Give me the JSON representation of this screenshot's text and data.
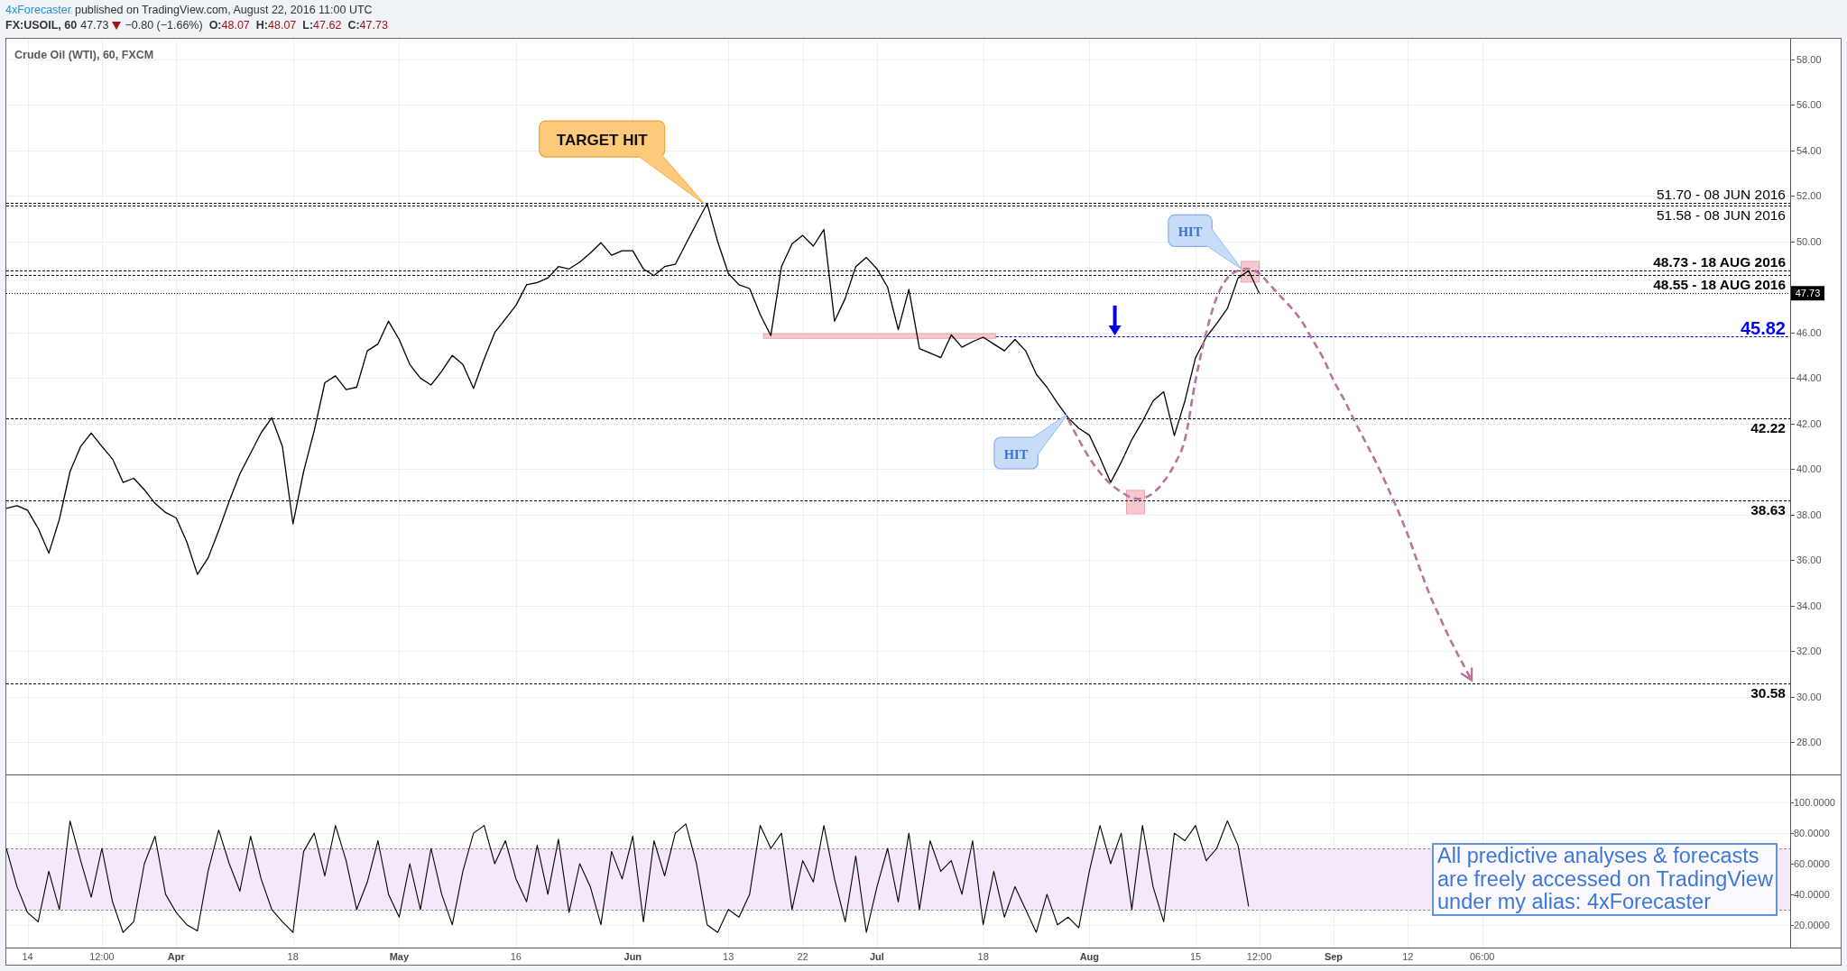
{
  "header": {
    "author": "4xForecaster",
    "published": "published on TradingView.com, August 22, 2016 11:00 UTC"
  },
  "quote": {
    "symbol": "FX:USOIL, 60",
    "last": "47.73",
    "falling": true,
    "change": "−0.80 (−1.66%)",
    "ohlc": [
      {
        "label": "O:",
        "value": "48.07"
      },
      {
        "label": "H:",
        "value": "48.07"
      },
      {
        "label": "L:",
        "value": "47.62"
      },
      {
        "label": "C:",
        "value": "47.73"
      }
    ]
  },
  "chart": {
    "price_pane": {
      "last_price_label": "47.73",
      "chart_data": {
        "type": "line",
        "title": "Crude Oil (WTI), 60, FXCM",
        "grid": true,
        "categories": [
          null,
          null,
          null,
          null,
          null,
          null,
          null,
          null,
          null,
          null,
          null,
          null,
          null,
          null,
          null,
          null,
          null,
          null,
          null,
          null,
          null,
          null,
          null,
          null,
          null,
          null,
          null,
          null,
          null,
          null,
          null,
          null,
          null,
          null,
          null,
          null,
          null,
          null,
          null,
          null,
          null,
          null,
          null,
          null,
          null,
          null,
          null,
          null,
          null,
          null,
          null,
          null,
          null,
          null,
          null,
          null,
          null,
          null,
          null,
          null,
          null,
          null,
          null,
          null,
          null,
          null,
          null,
          null,
          null,
          null,
          null,
          null,
          null,
          null,
          null,
          null,
          null,
          null,
          null,
          null,
          null,
          null,
          null,
          null,
          null,
          null,
          null,
          null,
          null,
          null,
          null,
          null,
          null,
          null,
          null,
          null,
          null,
          null,
          null,
          null,
          null,
          null,
          null,
          null,
          null,
          null,
          null,
          null,
          null,
          null,
          null,
          null,
          null,
          null,
          null,
          null,
          null,
          null,
          null,
          null,
          null,
          null,
          null,
          null,
          null,
          null,
          null,
          null,
          null,
          null,
          null,
          null,
          null,
          null,
          null,
          null,
          null,
          null,
          null,
          null,
          null,
          null,
          null,
          null,
          null,
          null,
          null,
          null,
          null,
          null,
          null,
          null,
          null,
          null,
          null,
          null,
          null,
          null,
          null,
          null,
          null,
          null,
          null,
          null,
          null,
          null,
          null,
          null,
          null
        ],
        "series": [
          {
            "color": "#000000",
            "values": [
              38.28,
              38.4,
              38.2,
              37.4,
              36.31,
              37.8,
              39.9,
              41.0,
              41.59,
              41.0,
              40.45,
              39.42,
              39.6,
              39.1,
              38.5,
              38.1,
              37.86,
              36.8,
              35.38,
              36.1,
              37.3,
              38.6,
              39.8,
              40.7,
              41.6,
              42.26,
              41.0,
              37.6,
              39.9,
              41.7,
              43.8,
              44.1,
              43.5,
              43.6,
              45.2,
              45.5,
              46.5,
              45.7,
              44.6,
              44.0,
              43.7,
              44.3,
              45.0,
              44.6,
              43.55,
              44.84,
              46.0,
              46.6,
              47.2,
              48.1,
              48.2,
              48.4,
              48.9,
              48.8,
              49.1,
              49.49,
              49.95,
              49.4,
              49.6,
              49.6,
              48.8,
              48.5,
              48.9,
              49.0,
              49.9,
              50.79,
              51.67,
              50.0,
              48.6,
              48.1,
              47.94,
              46.8,
              45.87,
              48.9,
              49.9,
              50.27,
              49.8,
              50.53,
              46.5,
              47.5,
              48.9,
              49.3,
              48.8,
              48.0,
              46.13,
              47.9,
              45.3,
              45.1,
              44.9,
              45.9,
              45.36,
              45.6,
              45.8,
              45.5,
              45.2,
              45.7,
              45.2,
              44.17,
              43.6,
              42.9,
              42.26,
              41.8,
              41.5,
              40.5,
              39.42,
              40.3,
              41.3,
              42.1,
              43.0,
              43.4,
              41.48,
              43.0,
              44.9,
              45.8,
              46.4,
              47.06,
              48.4,
              48.72,
              47.73,
              null,
              null,
              null,
              null,
              null,
              null,
              null,
              null,
              null,
              null,
              null,
              null,
              null,
              null,
              null,
              null,
              null,
              null,
              null,
              null,
              null,
              null,
              null,
              null,
              null,
              null,
              null,
              null,
              null,
              null,
              null,
              null,
              null,
              null,
              null,
              null,
              null,
              null,
              null,
              null,
              null,
              null,
              null,
              null,
              null,
              null,
              null,
              null,
              null,
              null
            ]
          },
          {
            "color": "#b8749c",
            "line_style": "dashed",
            "values": [
              null,
              null,
              null,
              null,
              null,
              null,
              null,
              null,
              null,
              null,
              null,
              null,
              null,
              null,
              null,
              null,
              null,
              null,
              null,
              null,
              null,
              null,
              null,
              null,
              null,
              null,
              null,
              null,
              null,
              null,
              null,
              null,
              null,
              null,
              null,
              null,
              null,
              null,
              null,
              null,
              null,
              null,
              null,
              null,
              null,
              null,
              null,
              null,
              null,
              null,
              null,
              null,
              null,
              null,
              null,
              null,
              null,
              null,
              null,
              null,
              null,
              null,
              null,
              null,
              null,
              null,
              null,
              null,
              null,
              null,
              null,
              null,
              null,
              null,
              null,
              null,
              null,
              null,
              null,
              null,
              null,
              null,
              null,
              null,
              null,
              null,
              null,
              null,
              null,
              null,
              null,
              null,
              null,
              null,
              null,
              null,
              null,
              null,
              null,
              null,
              42.2,
              41.3,
              40.5,
              39.85,
              39.35,
              39.0,
              38.75,
              38.72,
              38.95,
              39.45,
              40.2,
              41.3,
              43.9,
              46.0,
              47.55,
              48.4,
              48.72,
              48.8,
              48.6,
              48.1,
              47.6,
              47.1,
              46.5,
              45.7,
              44.9,
              43.9,
              43.05,
              42.1,
              41.2,
              40.3,
              39.3,
              38.25,
              37.1,
              35.8,
              34.55,
              33.5,
              32.5,
              31.6,
              30.73,
              null,
              null,
              null,
              null,
              null,
              null,
              null,
              null,
              null,
              null,
              null,
              null,
              null,
              null,
              null,
              null,
              null,
              null,
              null,
              null,
              null,
              null,
              null,
              null,
              null,
              null,
              null,
              null,
              null,
              null
            ]
          }
        ],
        "ylim": [
          26.59,
          58.91
        ],
        "yticks": [
          {
            "value": 58,
            "label": "58.00"
          },
          {
            "value": 56,
            "label": "56.00"
          },
          {
            "value": 54,
            "label": "54.00"
          },
          {
            "value": 52,
            "label": "52.00"
          },
          {
            "value": 50,
            "label": "50.00"
          },
          {
            "value": 46,
            "label": "46.00"
          },
          {
            "value": 44,
            "label": "44.00"
          },
          {
            "value": 42,
            "label": "42.00"
          },
          {
            "value": 40,
            "label": "40.00"
          },
          {
            "value": 38,
            "label": "38.00"
          },
          {
            "value": 36,
            "label": "36.00"
          },
          {
            "value": 34,
            "label": "34.00"
          },
          {
            "value": 32,
            "label": "32.00"
          },
          {
            "value": 30,
            "label": "30.00"
          },
          {
            "value": 28,
            "label": "28.00"
          }
        ],
        "ref_lines": [
          {
            "axis": "y",
            "value": 51.7,
            "label": "51.70 - 08 JUN 2016",
            "color": "#000000"
          },
          {
            "axis": "y",
            "value": 51.58,
            "label": "51.58 - 08 JUN 2016",
            "color": "#000000"
          },
          {
            "axis": "y",
            "value": 48.73,
            "label": "48.73 - 18 AUG 2016",
            "color": "#000000"
          },
          {
            "axis": "y",
            "value": 48.55,
            "label": "48.55 - 18 AUG 2016",
            "color": "#000000"
          },
          {
            "axis": "y",
            "value": 47.73,
            "color": "#000000"
          },
          {
            "axis": "y",
            "value": 45.82,
            "label": "45.82",
            "color": "#0000ff"
          },
          {
            "axis": "y",
            "value": 42.22,
            "label": "42.22",
            "color": "#000000"
          },
          {
            "axis": "y",
            "value": 38.63,
            "label": "38.63",
            "color": "#000000"
          },
          {
            "axis": "y",
            "value": 30.58,
            "label": "30.58",
            "color": "#000000"
          }
        ],
        "annotations": [
          "TARGET HIT",
          "HIT",
          "HIT"
        ]
      }
    },
    "oscillator_pane": {
      "note": "All predictive analyses & forecasts\nare freely accessed on TradingView\nunder my alias: 4xForecaster",
      "chart_data": {
        "type": "line",
        "grid": true,
        "categories": [
          null,
          null,
          "14",
          null,
          null,
          null,
          null,
          null,
          null,
          "12:00",
          null,
          null,
          null,
          null,
          null,
          null,
          "Apr",
          null,
          null,
          null,
          null,
          null,
          null,
          null,
          null,
          null,
          null,
          "18",
          null,
          null,
          null,
          null,
          null,
          null,
          null,
          null,
          null,
          "May",
          null,
          null,
          null,
          null,
          null,
          null,
          null,
          null,
          null,
          null,
          "16",
          null,
          null,
          null,
          null,
          null,
          null,
          null,
          null,
          null,
          null,
          "Jun",
          null,
          null,
          null,
          null,
          null,
          null,
          null,
          null,
          "13",
          null,
          null,
          null,
          null,
          null,
          null,
          "22",
          null,
          null,
          null,
          null,
          null,
          null,
          "Jul",
          null,
          null,
          null,
          null,
          null,
          null,
          null,
          null,
          null,
          "18",
          null,
          null,
          null,
          null,
          null,
          null,
          null,
          null,
          null,
          "Aug",
          null,
          null,
          null,
          null,
          null,
          null,
          null,
          null,
          null,
          "15",
          null,
          null,
          null,
          null,
          null,
          "12:00",
          null,
          null,
          null,
          null,
          null,
          null,
          "Sep",
          null,
          null,
          null,
          null,
          null,
          null,
          "12",
          null,
          null,
          null,
          null,
          null,
          null,
          "06:00",
          null,
          null,
          null,
          null,
          null,
          null,
          null,
          null,
          null,
          null,
          null,
          null,
          null,
          null,
          null,
          null,
          null,
          null,
          null,
          null,
          null,
          null,
          null,
          null,
          null,
          null,
          null,
          null,
          null
        ],
        "values": [
          70,
          45,
          28,
          22,
          55,
          30,
          88,
          62,
          38,
          70,
          35,
          15,
          22,
          60,
          78,
          40,
          28,
          20,
          16,
          55,
          82,
          60,
          42,
          78,
          50,
          30,
          22,
          15,
          68,
          80,
          52,
          85,
          62,
          30,
          48,
          75,
          40,
          25,
          60,
          30,
          70,
          40,
          20,
          55,
          80,
          85,
          60,
          75,
          50,
          35,
          72,
          40,
          76,
          28,
          60,
          45,
          20,
          68,
          50,
          78,
          22,
          75,
          52,
          80,
          86,
          60,
          20,
          15,
          30,
          25,
          40,
          85,
          70,
          80,
          30,
          62,
          48,
          85,
          50,
          22,
          65,
          15,
          45,
          70,
          35,
          80,
          30,
          75,
          55,
          62,
          40,
          75,
          20,
          55,
          25,
          45,
          30,
          15,
          40,
          20,
          25,
          18,
          55,
          85,
          60,
          80,
          30,
          85,
          45,
          22,
          80,
          75,
          85,
          62,
          70,
          88,
          72,
          32,
          null,
          null,
          null,
          null,
          null,
          null,
          null,
          null,
          null,
          null,
          null,
          null,
          null,
          null,
          null,
          null,
          null,
          null,
          null,
          null,
          null,
          null,
          null,
          null,
          null,
          null,
          null,
          null,
          null,
          null,
          null,
          null,
          null,
          null,
          null,
          null,
          null,
          null,
          null,
          null,
          null,
          null,
          null,
          null,
          null,
          null,
          null,
          null,
          null,
          null,
          null
        ],
        "ylim": [
          5.1,
          117.8
        ],
        "yticks": [
          {
            "value": 100,
            "label": "100.0000"
          },
          {
            "value": 80,
            "label": "80.0000"
          },
          {
            "value": 60,
            "label": "60.0000"
          },
          {
            "value": 40,
            "label": "40.0000"
          },
          {
            "value": 20,
            "label": "20.0000"
          }
        ],
        "ref_lines": [
          {
            "axis": "y",
            "value": 70,
            "color": "#9a89a6"
          },
          {
            "axis": "y",
            "value": 30,
            "color": "#9a89a6"
          }
        ],
        "bands": [
          {
            "axis": "y",
            "from": 30,
            "to": 70
          }
        ]
      }
    }
  }
}
